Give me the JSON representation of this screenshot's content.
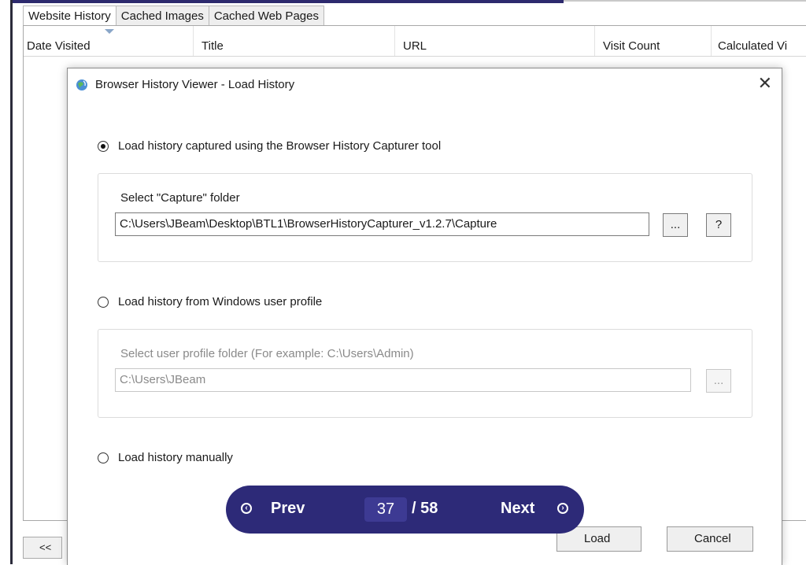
{
  "tabs": [
    "Website History",
    "Cached Images",
    "Cached Web Pages"
  ],
  "columns": [
    "Date Visited",
    "Title",
    "URL",
    "Visit Count",
    "Calculated Vi"
  ],
  "prev_pages_label": "<<",
  "dialog": {
    "title": "Browser History Viewer - Load History",
    "close_glyph": "✕",
    "option_capture": {
      "label": "Load history captured using the Browser History Capturer tool",
      "selected": true,
      "group_label": "Select \"Capture\" folder",
      "path": "C:\\Users\\JBeam\\Desktop\\BTL1\\BrowserHistoryCapturer_v1.2.7\\Capture",
      "browse_label": "...",
      "help_label": "?"
    },
    "option_profile": {
      "label": "Load history from Windows user profile",
      "selected": false,
      "group_label": "Select user profile folder (For example: C:\\Users\\Admin)",
      "path": "C:\\Users\\JBeam",
      "browse_label": "..."
    },
    "option_manual": {
      "label": "Load history manually",
      "selected": false
    },
    "load_label": "Load",
    "cancel_label": "Cancel"
  },
  "pager": {
    "prev_label": "Prev",
    "next_label": "Next",
    "current_page": "37",
    "total_pages": "/ 58"
  },
  "colors": {
    "pager_bg": "#2d2a78",
    "accent": "#2d2a6e"
  }
}
